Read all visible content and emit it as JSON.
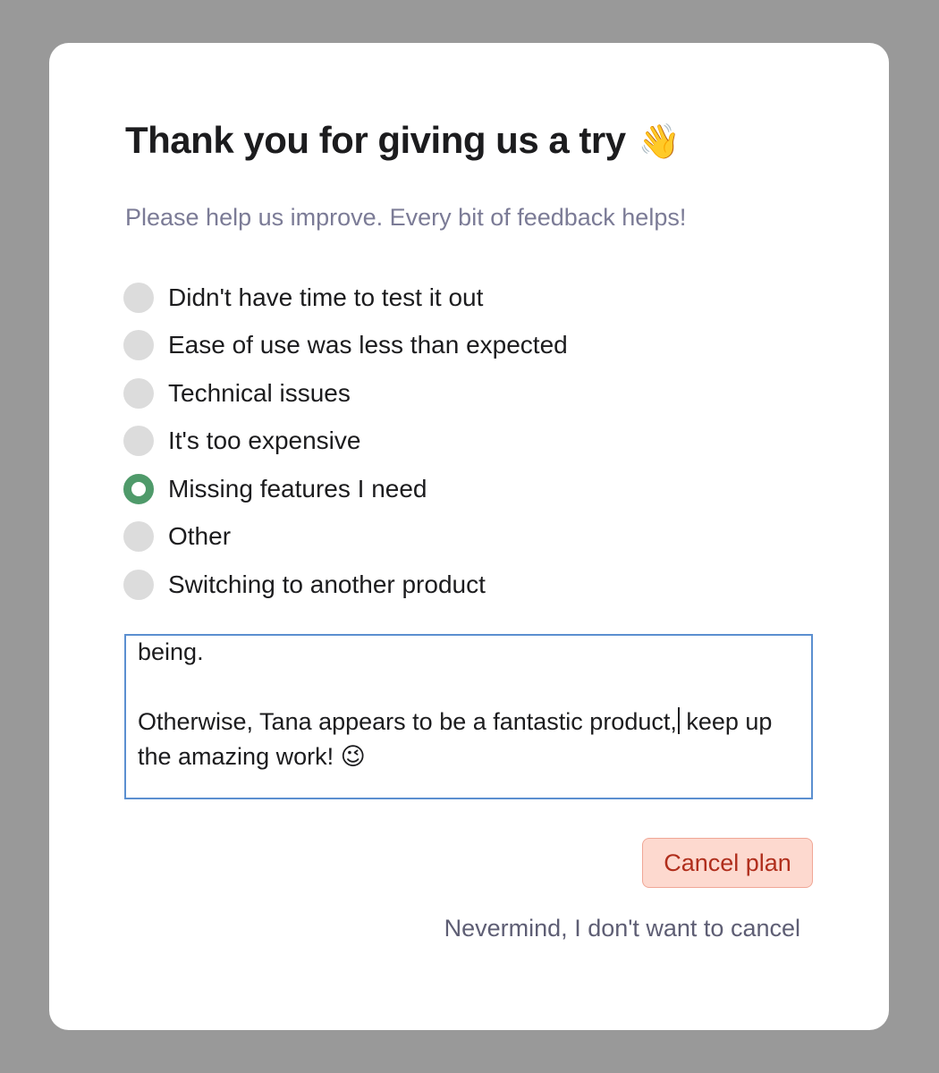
{
  "dialog": {
    "title": "Thank you for giving us a try",
    "title_emoji": "👋",
    "subtitle": "Please help us improve. Every bit of feedback helps!"
  },
  "options": [
    {
      "label": "Didn't have time to test it out",
      "selected": false
    },
    {
      "label": "Ease of use was less than expected",
      "selected": false
    },
    {
      "label": "Technical issues",
      "selected": false
    },
    {
      "label": "It's too expensive",
      "selected": false
    },
    {
      "label": "Missing features I need",
      "selected": true
    },
    {
      "label": "Other",
      "selected": false
    },
    {
      "label": "Switching to another product",
      "selected": false
    }
  ],
  "feedback": {
    "text_before_caret": "led me to decide to return to my Obsidian setup for the time being.\n\nOtherwise, Tana appears to be a fantastic product,",
    "text_after_caret": " keep up the amazing work! 😉"
  },
  "actions": {
    "cancel_plan_label": "Cancel plan",
    "nevermind_label": "Nevermind, I don't want to cancel"
  },
  "colors": {
    "accent_selected": "#4f9a6a",
    "danger_bg": "#fdd9cf",
    "danger_text": "#b02e1c",
    "focus_border": "#5b8fd0"
  }
}
